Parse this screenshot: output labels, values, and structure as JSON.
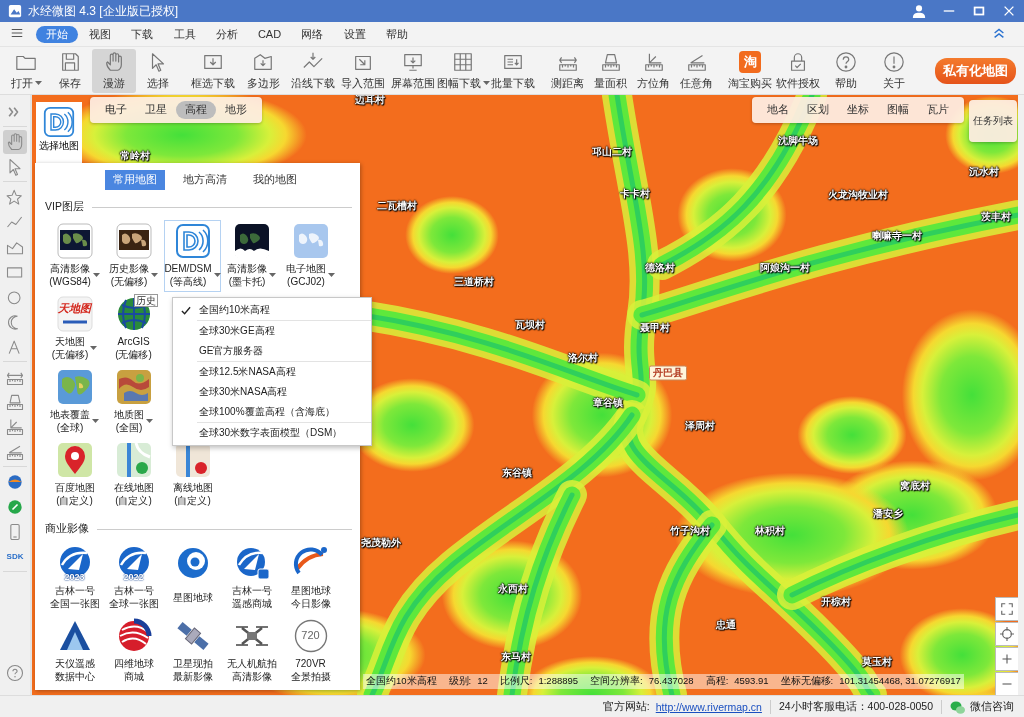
{
  "window": {
    "title": "水经微图 4.3 [企业版已授权]"
  },
  "menu": [
    {
      "label": "开始",
      "selected": true
    },
    {
      "label": "视图",
      "selected": false
    },
    {
      "label": "下载",
      "selected": false
    },
    {
      "label": "工具",
      "selected": false
    },
    {
      "label": "分析",
      "selected": false
    },
    {
      "label": "CAD",
      "selected": false
    },
    {
      "label": "网络",
      "selected": false
    },
    {
      "label": "设置",
      "selected": false
    },
    {
      "label": "帮助",
      "selected": false
    }
  ],
  "toolbar": {
    "groups": [
      [
        {
          "label": "打开",
          "dropdown": true,
          "selected": false
        },
        {
          "label": "保存",
          "dropdown": false,
          "selected": false
        },
        {
          "label": "漫游",
          "dropdown": false,
          "selected": true
        },
        {
          "label": "选择",
          "dropdown": false,
          "selected": false
        }
      ],
      [
        {
          "label": "框选下载",
          "dropdown": false,
          "selected": false
        },
        {
          "label": "多边形",
          "dropdown": false,
          "selected": false
        },
        {
          "label": "沿线下载",
          "dropdown": false,
          "selected": false
        },
        {
          "label": "导入范围",
          "dropdown": false,
          "selected": false
        },
        {
          "label": "屏幕范围",
          "dropdown": false,
          "selected": false
        },
        {
          "label": "图幅下载",
          "dropdown": true,
          "selected": false
        },
        {
          "label": "批量下载",
          "dropdown": false,
          "selected": false
        }
      ],
      [
        {
          "label": "测距离",
          "dropdown": false,
          "selected": false
        },
        {
          "label": "量面积",
          "dropdown": false,
          "selected": false
        },
        {
          "label": "方位角",
          "dropdown": false,
          "selected": false
        },
        {
          "label": "任意角",
          "dropdown": false,
          "selected": false
        }
      ],
      [
        {
          "label": "淘宝购买",
          "badge": "淘",
          "dropdown": false,
          "selected": false
        },
        {
          "label": "软件授权",
          "dropdown": false,
          "selected": false
        },
        {
          "label": "帮助",
          "dropdown": false,
          "selected": false
        },
        {
          "label": "关于",
          "dropdown": false,
          "selected": false
        }
      ]
    ],
    "private_button": "私有化地图"
  },
  "side_tools": {
    "groups": [
      [
        {
          "selected": false
        }
      ],
      [
        {
          "selected": true
        },
        {
          "selected": false
        }
      ],
      [
        {
          "selected": false
        },
        {
          "selected": false
        },
        {
          "selected": false
        },
        {
          "selected": false
        },
        {
          "selected": false
        },
        {
          "selected": false
        },
        {
          "selected": false
        }
      ],
      [
        {
          "selected": false
        },
        {
          "selected": false
        },
        {
          "selected": false
        },
        {
          "selected": false
        }
      ],
      [
        {
          "selected": false
        },
        {
          "selected": false
        },
        {
          "selected": false
        },
        {
          "label": "SDK",
          "selected": false
        }
      ]
    ]
  },
  "map": {
    "select_map": "选择地图",
    "base_tabs": [
      {
        "label": "电子",
        "selected": false
      },
      {
        "label": "卫星",
        "selected": false
      },
      {
        "label": "高程",
        "selected": true
      },
      {
        "label": "地形",
        "selected": false
      }
    ],
    "overlay_tabs": [
      "地名",
      "区划",
      "坐标",
      "图幅",
      "瓦片"
    ],
    "task_button": "任务列表",
    "places": [
      {
        "name": "迈耳村",
        "kind": "village"
      },
      {
        "name": "常岭村",
        "kind": "village"
      },
      {
        "name": "邛山二村",
        "kind": "village"
      },
      {
        "name": "沈脚牛场",
        "kind": "village"
      },
      {
        "name": "卡卡村",
        "kind": "village"
      },
      {
        "name": "火龙沟牧业村",
        "kind": "village"
      },
      {
        "name": "沉水村",
        "kind": "village"
      },
      {
        "name": "二瓦槽村",
        "kind": "village"
      },
      {
        "name": "茨丰村",
        "kind": "village"
      },
      {
        "name": "喇嘛寺一村",
        "kind": "village"
      },
      {
        "name": "德洛村",
        "kind": "village"
      },
      {
        "name": "阿娘沟一村",
        "kind": "village"
      },
      {
        "name": "三道桥村",
        "kind": "village"
      },
      {
        "name": "瓦坝村",
        "kind": "village"
      },
      {
        "name": "聂甲村",
        "kind": "village"
      },
      {
        "name": "洛尔村",
        "kind": "village"
      },
      {
        "name": "丹巴县",
        "kind": "county"
      },
      {
        "name": "章谷镇",
        "kind": "village"
      },
      {
        "name": "泽周村",
        "kind": "village"
      },
      {
        "name": "东谷镇",
        "kind": "village"
      },
      {
        "name": "窝底村",
        "kind": "village"
      },
      {
        "name": "潘安乡",
        "kind": "village"
      },
      {
        "name": "竹子沟村",
        "kind": "village"
      },
      {
        "name": "林积村",
        "kind": "village"
      },
      {
        "name": "尧茂勒外",
        "kind": "village"
      },
      {
        "name": "永西村",
        "kind": "village"
      },
      {
        "name": "开棕村",
        "kind": "village"
      },
      {
        "name": "忠通",
        "kind": "village"
      },
      {
        "name": "东马村",
        "kind": "village"
      },
      {
        "name": "莫玉村",
        "kind": "village"
      }
    ],
    "status": {
      "layer": "全国约10米高程",
      "fields": [
        {
          "label": "级别:",
          "value": "12"
        },
        {
          "label": "比例尺:",
          "value": "1:288895"
        },
        {
          "label": "空间分辨率:",
          "value": "76.437028"
        },
        {
          "label": "高程:",
          "value": "4593.91"
        },
        {
          "label": "坐标无偏移:",
          "value": "101.31454468, 31.07276917"
        }
      ]
    }
  },
  "map_panel": {
    "tabs": [
      {
        "label": "常用地图",
        "selected": true
      },
      {
        "label": "地方高清",
        "selected": false
      },
      {
        "label": "我的地图",
        "selected": false
      }
    ],
    "sections": [
      {
        "title": "VIP图层",
        "rows": [
          [
            {
              "lines": [
                "高清影像",
                "(WGS84)"
              ],
              "dropdown": true,
              "selected": false
            },
            {
              "lines": [
                "历史影像",
                "(无偏移)"
              ],
              "dropdown": true,
              "selected": false
            },
            {
              "lines": [
                "DEM/DSM",
                "(等高线)"
              ],
              "dropdown": true,
              "selected": true
            },
            {
              "lines": [
                "高清影像",
                "(墨卡托)"
              ],
              "dropdown": true,
              "selected": false
            },
            {
              "lines": [
                "电子地图",
                "(GCJ02)"
              ],
              "dropdown": true,
              "selected": false
            }
          ],
          [
            {
              "lines": [
                "天地图",
                "(无偏移)"
              ],
              "badge": "天地图",
              "dropdown": true,
              "selected": false
            },
            {
              "lines": [
                "ArcGIS",
                "(无偏移)"
              ],
              "badge": "历史",
              "dropdown": false,
              "selected": false
            }
          ],
          [
            {
              "lines": [
                "地表覆盖",
                "(全球)"
              ],
              "dropdown": true,
              "selected": false
            },
            {
              "lines": [
                "地质图",
                "(全国)"
              ],
              "dropdown": true,
              "selected": false
            }
          ],
          [
            {
              "lines": [
                "百度地图",
                "(自定义)"
              ],
              "dropdown": false,
              "selected": false
            },
            {
              "lines": [
                "在线地图",
                "(自定义)"
              ],
              "dropdown": false,
              "selected": false
            },
            {
              "lines": [
                "离线地图",
                "(自定义)"
              ],
              "dropdown": false,
              "selected": false
            }
          ]
        ]
      },
      {
        "title": "商业影像",
        "rows": [
          [
            {
              "lines": [
                "吉林一号",
                "全国一张图"
              ],
              "badge": "2023",
              "dropdown": false,
              "selected": false
            },
            {
              "lines": [
                "吉林一号",
                "全球一张图"
              ],
              "badge": "2022",
              "dropdown": false,
              "selected": false
            },
            {
              "lines": [
                "星图地球"
              ],
              "dropdown": false,
              "selected": false
            },
            {
              "lines": [
                "吉林一号",
                "遥感商城"
              ],
              "dropdown": false,
              "selected": false
            },
            {
              "lines": [
                "星图地球",
                "今日影像"
              ],
              "dropdown": false,
              "selected": false
            }
          ],
          [
            {
              "lines": [
                "天仪遥感",
                "数据中心"
              ],
              "dropdown": false,
              "selected": false
            },
            {
              "lines": [
                "四维地球",
                "商城"
              ],
              "dropdown": false,
              "selected": false
            },
            {
              "lines": [
                "卫星现拍",
                "最新影像"
              ],
              "dropdown": false,
              "selected": false
            },
            {
              "lines": [
                "无人机航拍",
                "高清影像"
              ],
              "dropdown": false,
              "selected": false
            },
            {
              "lines": [
                "720VR",
                "全景拍摄"
              ],
              "badge": "720",
              "dropdown": false,
              "selected": false
            }
          ]
        ]
      }
    ]
  },
  "layer_menu": {
    "groups": [
      [
        {
          "label": "全国约10米高程",
          "checked": true
        }
      ],
      [
        {
          "label": "全球30米GE高程",
          "checked": false
        },
        {
          "label": "GE官方服务器",
          "checked": false
        }
      ],
      [
        {
          "label": "全球12.5米NASA高程",
          "checked": false
        },
        {
          "label": "全球30米NASA高程",
          "checked": false
        },
        {
          "label": "全球100%覆盖高程（含海底）",
          "checked": false
        }
      ],
      [
        {
          "label": "全球30米数字表面模型（DSM）",
          "checked": false
        }
      ]
    ]
  },
  "status_bar": {
    "website_label": "官方网站:",
    "website_link": "http://www.rivermap.cn",
    "hotline": "24小时客服电话：400-028-0050",
    "wechat": "微信咨询"
  }
}
